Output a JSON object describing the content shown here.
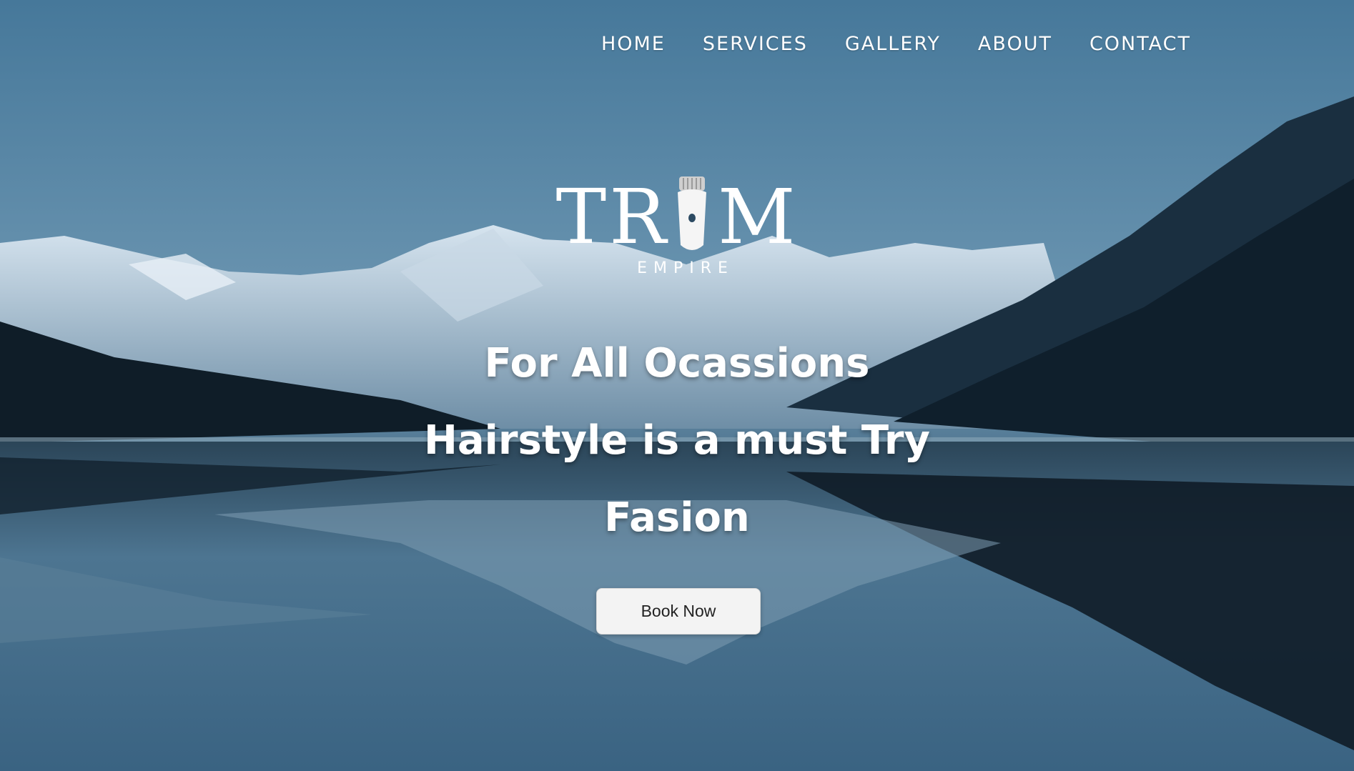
{
  "nav": {
    "items": [
      {
        "label": "HOME"
      },
      {
        "label": "SERVICES"
      },
      {
        "label": "GALLERY"
      },
      {
        "label": "ABOUT"
      },
      {
        "label": "CONTACT"
      }
    ]
  },
  "logo": {
    "word_left": "TR",
    "word_right": "M",
    "clipper_icon": "hair-clipper-icon",
    "subtitle": "EMPIRE"
  },
  "hero": {
    "lines": [
      "For All Ocassions",
      "Hairstyle is a must Try",
      "Fasion"
    ],
    "button_label": "Book Now"
  },
  "colors": {
    "sky_top": "#4a7a9a",
    "water": "#2e5370",
    "text": "#ffffff",
    "button_bg": "#f3f3f3"
  }
}
